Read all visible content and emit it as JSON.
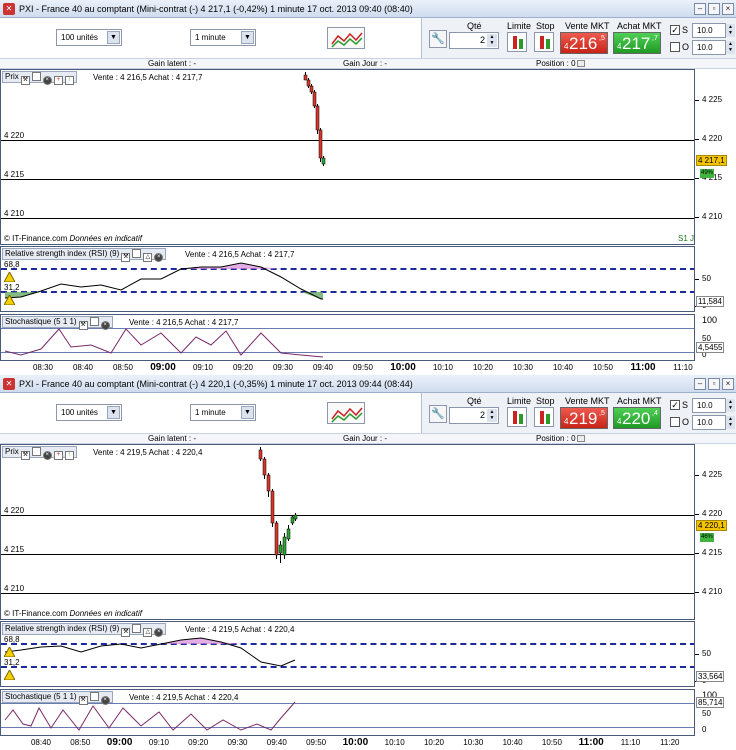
{
  "icons": {
    "app": "pxi-logo-icon",
    "minimize": "minimize-icon",
    "maximize": "maximize-icon",
    "close": "close-icon",
    "chart_type": "chart-type-icon",
    "settings": "wrench-icon",
    "limit": "limit-order-icon",
    "stop": "stop-order-icon",
    "alert": "warning-icon",
    "position": "position-icon"
  },
  "colors": {
    "sell": "#d9352a",
    "buy": "#2da632",
    "dash": "#1d2a9c",
    "rsi_high": "#d98ad9",
    "rsi_low": "#66aa66"
  },
  "windows": [
    {
      "title": "PXI - France 40 au comptant (Mini-contrat  (-)   4 217,1 (-0,42%)     1 minute   17 oct. 2013 09:40 (08:40)",
      "lot_select": "100 unités",
      "period_select": "1 minute",
      "qty_label": "Qté",
      "qty": "2",
      "limit_label": "Limite",
      "stop_label": "Stop",
      "sell_label": "Vente MKT",
      "sell_small": "4",
      "sell_big": "216",
      "sell_sup": ",5",
      "buy_label": "Achat MKT",
      "buy_small": "4",
      "buy_big": "217",
      "buy_sup": ",7",
      "chk_s_mark": "✓",
      "chk_s": "S",
      "chk_o": "O",
      "stop_s": "10.0",
      "stop_o": "10.0",
      "gain_latent": "Gain latent : -",
      "gain_jour": "Gain Jour : -",
      "position": "Position : 0",
      "price_panel": {
        "tag": "Prix",
        "quote": "Vente : 4 216,5 Achat : 4 217,7",
        "axis": [
          "4 225",
          "4 220",
          "4 215",
          "4 210"
        ],
        "left_levels": [
          "4 220",
          "4 215",
          "4 210"
        ],
        "last_price": "4 217,1",
        "pct": "49%",
        "credit": "© IT-Finance.com",
        "credit_em": "Données en indicatif",
        "corner": "S1 J"
      },
      "rsi_panel": {
        "tag": "Relative strength index (RSI) (9)",
        "quote": "Vente : 4 216,5 Achat : 4 217,7",
        "high": "68,8",
        "low": "31,2",
        "axis": [
          "50",
          "0"
        ],
        "value": "11,584"
      },
      "stoch_panel": {
        "tag": "Stochastique (5 1 1)",
        "quote": "Vente : 4 216,5 Achat : 4 217,7",
        "axis": [
          "100",
          "50",
          "0"
        ],
        "value": "4,5455"
      },
      "xaxis": [
        {
          "t": "08:30",
          "m": false
        },
        {
          "t": "08:40",
          "m": false
        },
        {
          "t": "08:50",
          "m": false
        },
        {
          "t": "09:00",
          "m": true
        },
        {
          "t": "09:10",
          "m": false
        },
        {
          "t": "09:20",
          "m": false
        },
        {
          "t": "09:30",
          "m": false
        },
        {
          "t": "09:40",
          "m": false
        },
        {
          "t": "09:50",
          "m": false
        },
        {
          "t": "10:00",
          "m": true
        },
        {
          "t": "10:10",
          "m": false
        },
        {
          "t": "10:20",
          "m": false
        },
        {
          "t": "10:30",
          "m": false
        },
        {
          "t": "10:40",
          "m": false
        },
        {
          "t": "10:50",
          "m": false
        },
        {
          "t": "11:00",
          "m": true
        },
        {
          "t": "11:10",
          "m": false
        }
      ]
    },
    {
      "title": "PXI - France 40 au comptant (Mini-contrat  (-)   4 220,1 (-0,35%)     1 minute   17 oct. 2013 09:44 (08:44)",
      "lot_select": "100 unités",
      "period_select": "1 minute",
      "qty_label": "Qté",
      "qty": "2",
      "limit_label": "Limite",
      "stop_label": "Stop",
      "sell_label": "Vente MKT",
      "sell_small": "4",
      "sell_big": "219",
      "sell_sup": ",5",
      "buy_label": "Achat MKT",
      "buy_small": "4",
      "buy_big": "220",
      "buy_sup": ",4",
      "chk_s_mark": "✓",
      "chk_s": "S",
      "chk_o": "O",
      "stop_s": "10.0",
      "stop_o": "10.0",
      "gain_latent": "Gain latent : -",
      "gain_jour": "Gain Jour : -",
      "position": "Position : 0",
      "price_panel": {
        "tag": "Prix",
        "quote": "Vente : 4 219,5 Achat : 4 220,4",
        "axis": [
          "4 225",
          "4 220",
          "4 215",
          "4 210"
        ],
        "left_levels": [
          "4 220",
          "4 215",
          "4 210"
        ],
        "last_price": "4 220,1",
        "pct": "46%",
        "credit": "© IT-Finance.com",
        "credit_em": "Données en indicatif",
        "corner": ""
      },
      "rsi_panel": {
        "tag": "Relative strength index (RSI) (9)",
        "quote": "Vente : 4 219,5 Achat : 4 220,4",
        "high": "68,8",
        "low": "31,2",
        "axis": [
          "50",
          "0"
        ],
        "value": "33,564"
      },
      "stoch_panel": {
        "tag": "Stochastique (5 1 1)",
        "quote": "Vente : 4 219,5 Achat : 4 220,4",
        "axis": [
          "100",
          "50",
          "0"
        ],
        "value": "85,714"
      },
      "xaxis": [
        {
          "t": "08:40",
          "m": false
        },
        {
          "t": "08:50",
          "m": false
        },
        {
          "t": "09:00",
          "m": true
        },
        {
          "t": "09:10",
          "m": false
        },
        {
          "t": "09:20",
          "m": false
        },
        {
          "t": "09:30",
          "m": false
        },
        {
          "t": "09:40",
          "m": false
        },
        {
          "t": "09:50",
          "m": false
        },
        {
          "t": "10:00",
          "m": true
        },
        {
          "t": "10:10",
          "m": false
        },
        {
          "t": "10:20",
          "m": false
        },
        {
          "t": "10:30",
          "m": false
        },
        {
          "t": "10:40",
          "m": false
        },
        {
          "t": "10:50",
          "m": false
        },
        {
          "t": "11:00",
          "m": true
        },
        {
          "t": "11:10",
          "m": false
        },
        {
          "t": "11:20",
          "m": false
        }
      ]
    }
  ]
}
